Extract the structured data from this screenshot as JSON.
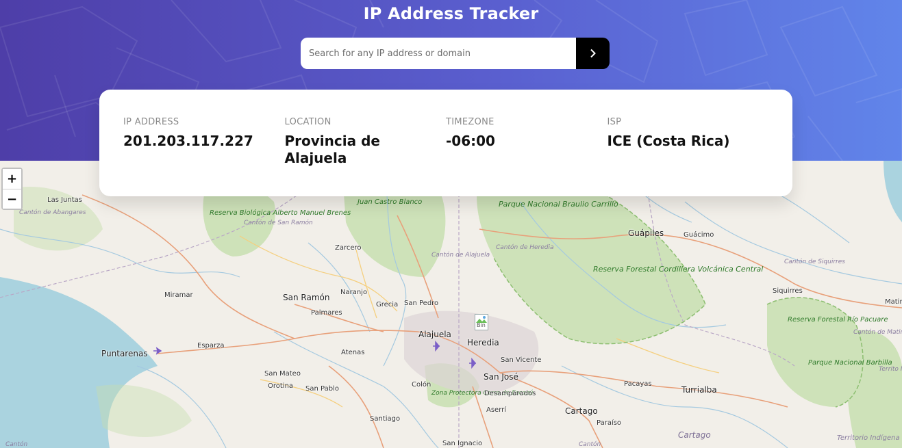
{
  "header": {
    "title": "IP Address Tracker"
  },
  "search": {
    "placeholder": "Search for any IP address or domain",
    "value": "",
    "submit_icon": "chevron-right-icon"
  },
  "info": {
    "ip_label": "IP ADDRESS",
    "ip_value": "201.203.117.227",
    "location_label": "LOCATION",
    "location_value": "Provincia de Alajuela",
    "timezone_label": "TIMEZONE",
    "timezone_value": "-06:00",
    "isp_label": "ISP",
    "isp_value": "ICE (Costa Rica)"
  },
  "map": {
    "zoom_in": "+",
    "zoom_out": "−",
    "marker_alt": "Bin",
    "labels": {
      "las_juntas": "Las Juntas",
      "canton_abangares": "Cantón de Abangares",
      "reserva_alberto": "Reserva Biológica Alberto Manuel Brenes",
      "canton_san_ramon": "Cantón de San Ramón",
      "juan_castro": "Juan Castro Blanco",
      "braulio": "Parque Nacional Braulio Carrillo",
      "canton_heredia": "Cantón de Heredia",
      "canton_alajuela": "Cantón de Alajuela",
      "guapiles": "Guápiles",
      "guacimo": "Guácimo",
      "zarcero": "Zarcero",
      "reserva_central": "Reserva Forestal Cordillera Volcánica Central",
      "canton_siquirres": "Cantón de Siquirres",
      "miramar": "Miramar",
      "san_ramon": "San Ramón",
      "naranjo": "Naranjo",
      "grecia": "Grecia",
      "san_pedro": "San Pedro",
      "palmares": "Palmares",
      "siquirres": "Siquirres",
      "matina": "Matin",
      "alajuela": "Alajuela",
      "heredia": "Heredia",
      "reserva_pacuare": "Reserva Forestal Río Pacuare",
      "canton_matina": "Cantón de Matina",
      "puntarenas": "Puntarenas",
      "esparza": "Esparza",
      "atenas": "Atenas",
      "san_vicente": "San Vicente",
      "san_jose": "San José",
      "san_mateo": "San Mateo",
      "orotina": "Orotina",
      "san_pablo": "San Pablo",
      "colon": "Colón",
      "escazu": "Zona Protectora Cerro de Escazú",
      "desamparados": "Desamparados",
      "pacayas": "Pacayas",
      "turrialba": "Turrialba",
      "barbilla": "Parque Nacional Barbilla",
      "territorio_cabecar": "Territo Indíge Cabéc de Ba Chirrip",
      "santiago": "Santiago",
      "aserri": "Aserrí",
      "cartago": "Cartago",
      "paraiso": "Paraíso",
      "cartago_region": "Cartago",
      "san_ignacio": "San Ignacio",
      "canton_bottom_left": "Cantón",
      "canton_bottom_mid": "Cantón",
      "territorio_indigena": "Territorio Indígena"
    }
  }
}
